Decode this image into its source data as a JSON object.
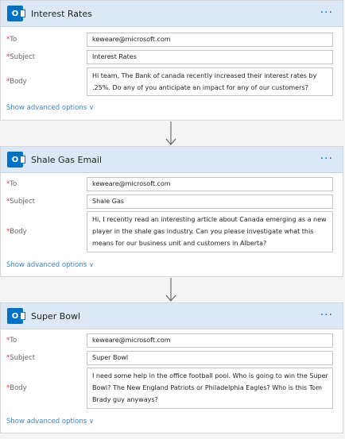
{
  "cards": [
    {
      "title": "Interest Rates",
      "more": "···",
      "to_label": "To",
      "to": "keweare@microsoft.com",
      "subject_label": "Subject",
      "subject": "Interest Rates",
      "body_label": "Body",
      "body": "Hi team, The Bank of canada recently increased their interest rates by .25%. Do any of you anticipate an impact for any of our customers?",
      "advanced": "Show advanced options ∨"
    },
    {
      "title": "Shale Gas Email",
      "more": "···",
      "to_label": "To",
      "to": "keweare@microsoft.com",
      "subject_label": "Subject",
      "subject": "Shale Gas",
      "body_label": "Body",
      "body": "Hi, I recently read an interesting article about Canada emerging as a new player in the shale gas industry.  Can you please investigate what this means for our business unit and customers in Alberta?",
      "advanced": "Show advanced options ∨"
    },
    {
      "title": "Super Bowl",
      "more": "···",
      "to_label": "To",
      "to": "keweare@microsoft.com",
      "subject_label": "Subject",
      "subject": "Super Bowl",
      "body_label": "Body",
      "body": "I need some help in the office football pool.  Who is going to win the Super Bowl? The New England Patriots or Philadelphia Eagles? Who is this Tom Brady guy anyways?",
      "advanced": "Show advanced options ∨"
    }
  ],
  "colors": {
    "header_bg": "#dde8f6",
    "outlook_blue": "#0072c6",
    "required_red": "#d13438",
    "link_blue": "#3a87cf"
  },
  "icons": {
    "outlook": "outlook-icon",
    "more": "more-options-icon",
    "arrow": "down-arrow-icon"
  }
}
